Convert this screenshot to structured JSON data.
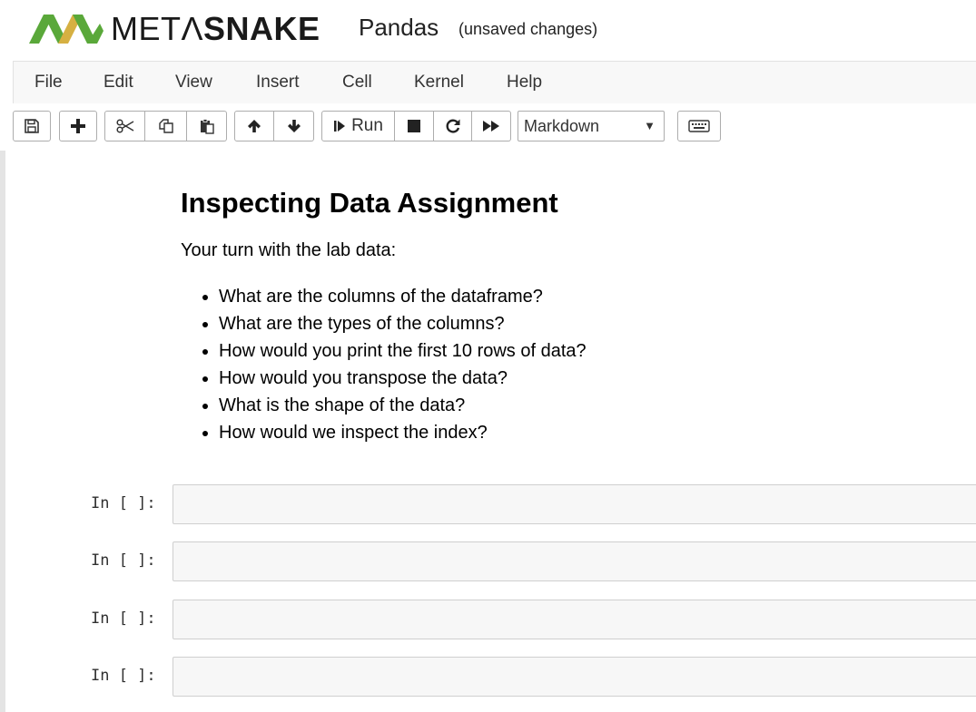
{
  "header": {
    "brand_part1": "METΛ",
    "brand_part2": "SNAKE",
    "notebook_name": "Pandas",
    "save_status": "(unsaved changes)",
    "logo_colors": {
      "green": "#5aa83a",
      "gold": "#d6b042"
    }
  },
  "menubar": {
    "items": [
      "File",
      "Edit",
      "View",
      "Insert",
      "Cell",
      "Kernel",
      "Help"
    ]
  },
  "toolbar": {
    "icons": [
      "save-icon",
      "plus-icon",
      "scissors-icon",
      "copy-icon",
      "paste-icon",
      "arrow-up-icon",
      "arrow-down-icon",
      "step-forward-icon",
      "stop-icon",
      "refresh-icon",
      "fast-forward-icon",
      "keyboard-icon"
    ],
    "run_label": "Run",
    "cell_type": "Markdown"
  },
  "markdown_cell": {
    "title": "Inspecting Data Assignment",
    "intro": "Your turn with the lab data:",
    "bullets": [
      "What are the columns of the dataframe?",
      "What are the types of the columns?",
      "How would you print the first 10 rows of data?",
      "How would you transpose the data?",
      "What is the shape of the data?",
      "How would we inspect the index?"
    ]
  },
  "code_cells": [
    {
      "prompt": "In [ ]:"
    },
    {
      "prompt": "In [ ]:"
    },
    {
      "prompt": "In [ ]:"
    },
    {
      "prompt": "In [ ]:"
    }
  ]
}
